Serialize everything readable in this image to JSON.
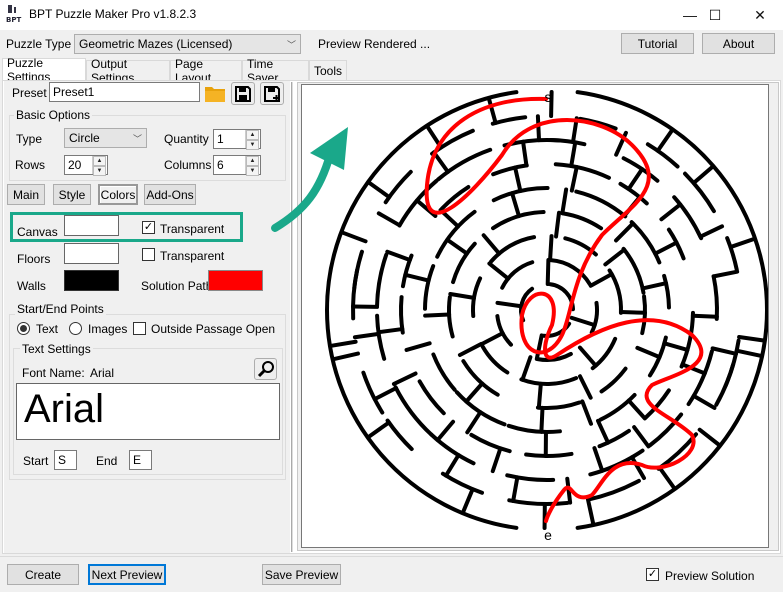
{
  "window": {
    "title": "BPT Puzzle Maker Pro v1.8.2.3",
    "icon": "bpt-logo-icon",
    "minimize_glyph": "—",
    "maximize_glyph": "☐",
    "close_glyph": "✕"
  },
  "toolbar": {
    "puzzle_type_label": "Puzzle Type",
    "puzzle_type_value": "Geometric Mazes (Licensed)",
    "status": "Preview Rendered ...",
    "tutorial_label": "Tutorial",
    "about_label": "About"
  },
  "tabs": [
    {
      "label": "Puzzle Settings",
      "active": true
    },
    {
      "label": "Output Settings",
      "active": false
    },
    {
      "label": "Page Layout",
      "active": false
    },
    {
      "label": "Time Saver",
      "active": false
    },
    {
      "label": "Tools",
      "active": false
    }
  ],
  "preset": {
    "label": "Preset",
    "value": "Preset1",
    "open_icon": "folder-icon",
    "save_icon": "save-icon",
    "save_as_icon": "save-plus-icon"
  },
  "basic_options": {
    "legend": "Basic Options",
    "type_label": "Type",
    "type_value": "Circle",
    "quantity_label": "Quantity",
    "quantity_value": "1",
    "rows_label": "Rows",
    "rows_value": "20",
    "columns_label": "Columns",
    "columns_value": "6"
  },
  "subtabs": [
    {
      "label": "Main",
      "active": false
    },
    {
      "label": "Style",
      "active": false
    },
    {
      "label": "Colors",
      "active": true
    },
    {
      "label": "Add-Ons",
      "active": false
    }
  ],
  "colors": {
    "canvas_label": "Canvas",
    "canvas_color": "#ffffff",
    "canvas_transparent_label": "Transparent",
    "canvas_transparent_checked": true,
    "floors_label": "Floors",
    "floors_color": "#ffffff",
    "floors_transparent_label": "Transparent",
    "floors_transparent_checked": false,
    "walls_label": "Walls",
    "walls_color": "#000000",
    "solution_label": "Solution Path",
    "solution_color": "#ff0000"
  },
  "start_end": {
    "legend": "Start/End Points",
    "text_label": "Text",
    "text_selected": true,
    "images_label": "Images",
    "images_selected": false,
    "outside_label": "Outside Passage Open",
    "outside_checked": false
  },
  "text_settings": {
    "legend": "Text Settings",
    "font_name_label": "Font Name:",
    "font_name_value": "Arial",
    "font_preview": "Arial",
    "font_button_icon": "magnifier-icon",
    "start_label": "Start",
    "start_value": "S",
    "end_label": "End",
    "end_value": "E"
  },
  "preview": {
    "start_marker": "s",
    "end_marker": "e",
    "wall_color": "#000000",
    "path_color": "#ff0000"
  },
  "annotation": {
    "highlight_color": "#1aa88a",
    "arrow_color": "#1aa88a"
  },
  "footer": {
    "create_label": "Create",
    "next_preview_label": "Next Preview",
    "save_preview_label": "Save Preview",
    "preview_solution_label": "Preview Solution",
    "preview_solution_checked": true
  }
}
